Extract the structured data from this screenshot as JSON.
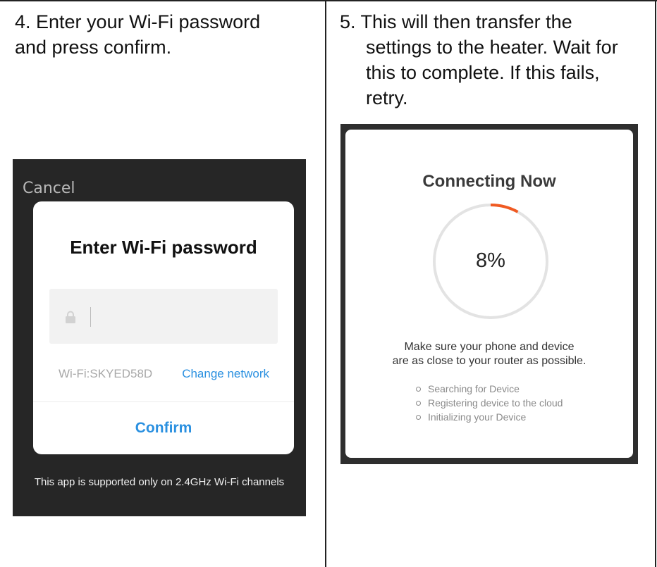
{
  "step4": {
    "line1": "4. Enter your Wi-Fi password",
    "line2": "and press confirm."
  },
  "step5": {
    "line1": "5. This will then transfer the",
    "line2": "settings to the heater. Wait for",
    "line3": "this to complete. If this fails,",
    "line4": "retry."
  },
  "wifi_dialog": {
    "cancel_label": "Cancel",
    "title": "Enter Wi-Fi password",
    "password_value": "",
    "lock_icon": "lock-icon",
    "wifi_name": "Wi-Fi:SKYED58D",
    "change_network_label": "Change network",
    "confirm_label": "Confirm",
    "footnote": "This app is supported only on 2.4GHz Wi-Fi channels",
    "accent_color": "#2a90e0"
  },
  "connecting": {
    "title": "Connecting Now",
    "progress_percent": 8,
    "progress_label": "8%",
    "progress_color": "#f05a22",
    "tip_line1": "Make sure your phone and device",
    "tip_line2": "are as close to your router as possible.",
    "status_items": [
      "Searching for Device",
      "Registering device to the cloud",
      "Initializing your Device"
    ]
  }
}
